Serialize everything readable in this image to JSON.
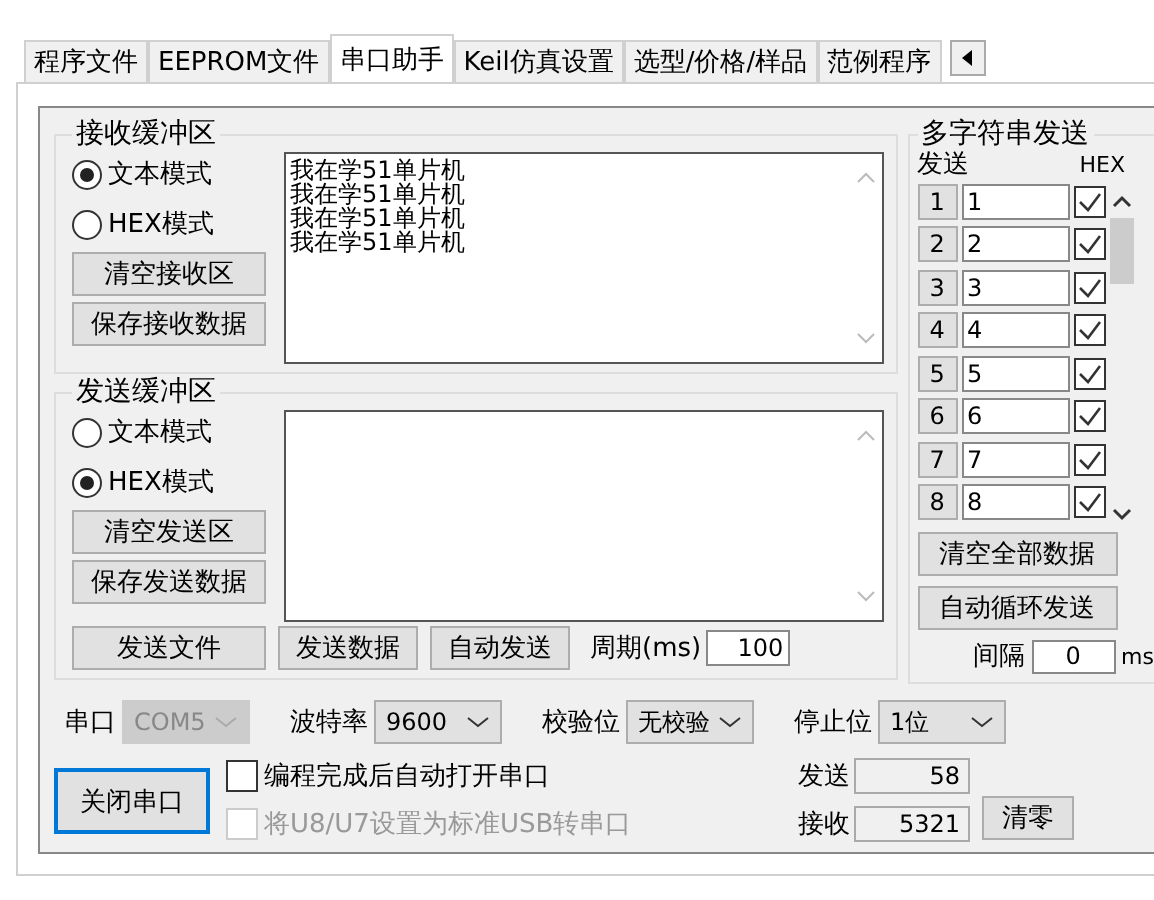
{
  "tabs": [
    {
      "label": "程序文件",
      "selected": false
    },
    {
      "label": "EEPROM文件",
      "selected": false
    },
    {
      "label": "串口助手",
      "selected": true
    },
    {
      "label": "Keil仿真设置",
      "selected": false
    },
    {
      "label": "选型/价格/样品",
      "selected": false
    },
    {
      "label": "范例程序",
      "selected": false
    }
  ],
  "receive_buffer": {
    "title": "接收缓冲区",
    "modes": [
      {
        "label": "文本模式",
        "selected": true
      },
      {
        "label": "HEX模式",
        "selected": false
      }
    ],
    "buttons": [
      "清空接收区",
      "保存接收数据"
    ],
    "lines": [
      "我在学51单片机",
      "我在学51单片机",
      "我在学51单片机",
      "我在学51单片机"
    ]
  },
  "send_buffer": {
    "title": "发送缓冲区",
    "modes": [
      {
        "label": "文本模式",
        "selected": false
      },
      {
        "label": "HEX模式",
        "selected": true
      }
    ],
    "buttons": [
      "清空发送区",
      "保存发送数据"
    ]
  },
  "send_actions": [
    "发送文件",
    "发送数据",
    "自动发送"
  ],
  "period": {
    "label": "周期(ms)",
    "value": "100"
  },
  "multi_send": {
    "title": "多字符串发送",
    "send_header": "发送",
    "hex_header": "HEX",
    "rows": [
      {
        "index": "1",
        "value": "1",
        "hex": true
      },
      {
        "index": "2",
        "value": "2",
        "hex": true
      },
      {
        "index": "3",
        "value": "3",
        "hex": true
      },
      {
        "index": "4",
        "value": "4",
        "hex": true
      },
      {
        "index": "5",
        "value": "5",
        "hex": true
      },
      {
        "index": "6",
        "value": "6",
        "hex": true
      },
      {
        "index": "7",
        "value": "7",
        "hex": true
      },
      {
        "index": "8",
        "value": "8",
        "hex": true
      }
    ],
    "buttons": [
      "清空全部数据",
      "自动循环发送"
    ],
    "interval": {
      "label": "间隔",
      "value": "0",
      "unit": "ms"
    }
  },
  "settings": [
    {
      "label": "串口",
      "value": "COM5",
      "disabled": true
    },
    {
      "label": "波特率",
      "value": "9600",
      "disabled": false
    },
    {
      "label": "校验位",
      "value": "无校验",
      "disabled": false
    },
    {
      "label": "停止位",
      "value": "1位",
      "disabled": false
    }
  ],
  "close_button": "关闭串口",
  "options": [
    {
      "label": "编程完成后自动打开串口",
      "checked": false,
      "disabled": false
    },
    {
      "label": "将U8/U7设置为标准USB转串口",
      "checked": false,
      "disabled": true
    }
  ],
  "counters": [
    {
      "label": "发送",
      "value": "58"
    },
    {
      "label": "接收",
      "value": "5321"
    }
  ],
  "clear_button": "清零"
}
